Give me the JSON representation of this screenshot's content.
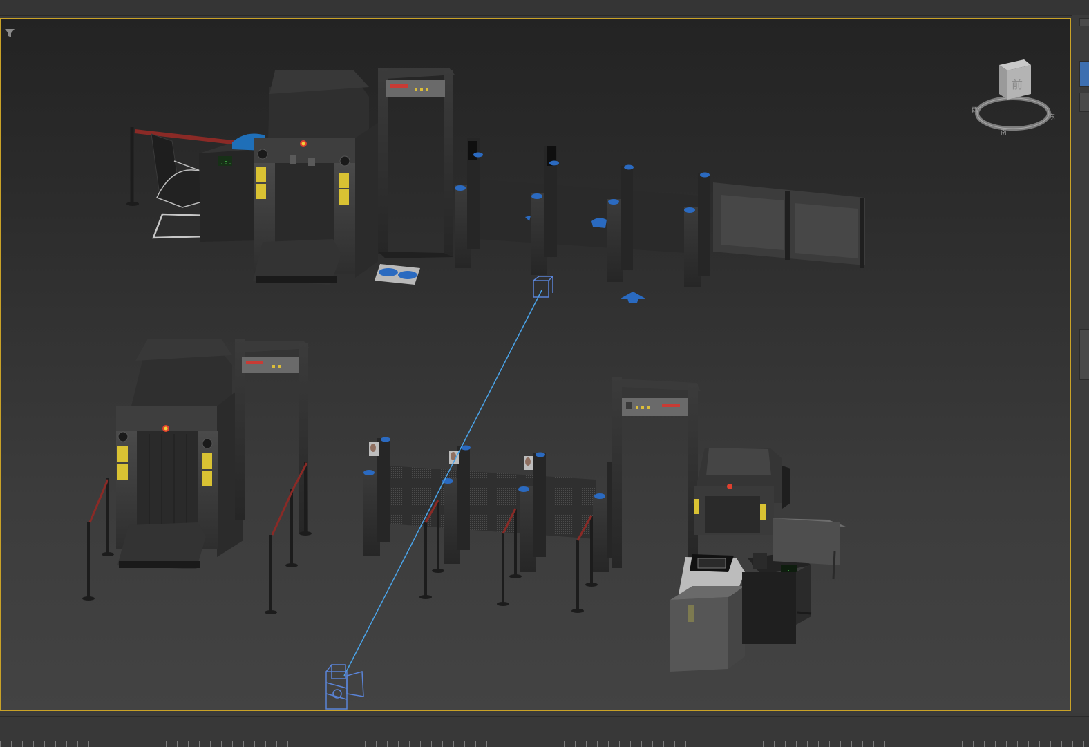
{
  "app": {
    "name": "3D viewport"
  },
  "viewport": {
    "state": "active",
    "border_color": "#c9a227",
    "filter_icon": "filter-icon"
  },
  "viewcube": {
    "face_label": "前",
    "compass": {
      "west": "西",
      "south": "南",
      "east": "东"
    }
  },
  "right_strip": {
    "buttons": [
      "top",
      "active-tool",
      "middle",
      "bottom"
    ]
  },
  "colors": {
    "selection": "#3d7fc4",
    "camera_line": "#4aa3e8",
    "accent_red": "#d23b2f",
    "warning_yellow": "#d9c233"
  },
  "timeline": {
    "ruler": "frame-ticks"
  }
}
